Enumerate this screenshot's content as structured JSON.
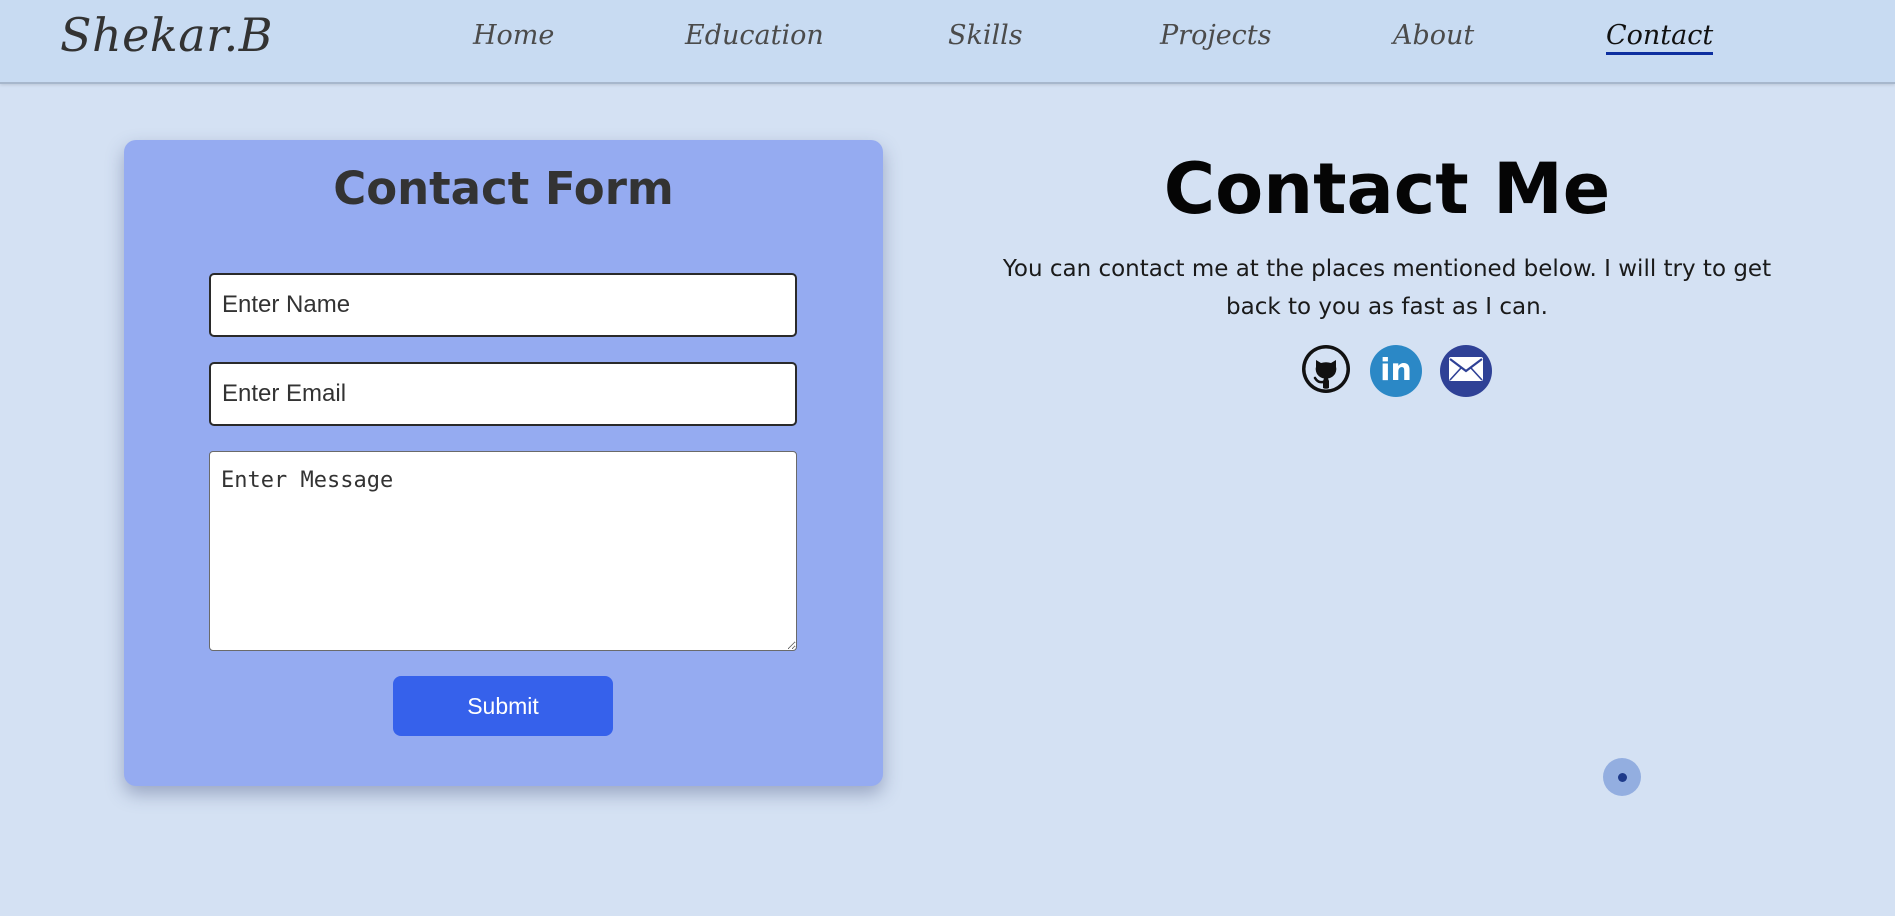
{
  "brand": "Shekar.B",
  "nav": {
    "items": [
      {
        "label": "Home"
      },
      {
        "label": "Education"
      },
      {
        "label": "Skills"
      },
      {
        "label": "Projects"
      },
      {
        "label": "About"
      },
      {
        "label": "Contact",
        "active": true
      }
    ]
  },
  "form": {
    "title": "Contact Form",
    "name_placeholder": "Enter Name",
    "email_placeholder": "Enter Email",
    "message_placeholder": "Enter Message",
    "submit_label": "Submit"
  },
  "contact": {
    "title": "Contact Me",
    "text": "You can contact me at the places mentioned below. I will try to get back to you as fast as I can.",
    "socials": [
      {
        "icon": "github-icon"
      },
      {
        "icon": "linkedin-icon",
        "text": "in"
      },
      {
        "icon": "email-icon"
      }
    ]
  },
  "colors": {
    "background": "#d4e1f3",
    "navbar": "#c8dbf2",
    "card": "#95abf1",
    "submit": "#3661eb",
    "active_underline": "#0d2fa0",
    "linkedin": "#2b88c6",
    "email": "#2f4196"
  }
}
